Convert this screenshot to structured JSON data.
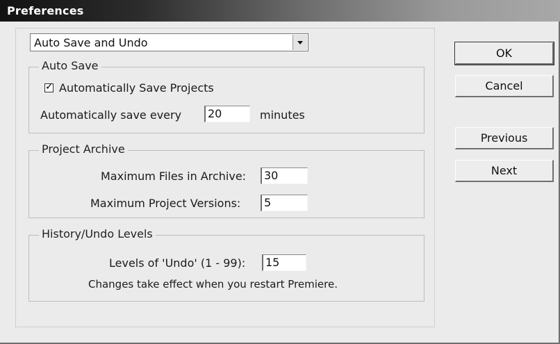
{
  "window": {
    "title": "Preferences"
  },
  "category_select": {
    "value": "Auto Save and Undo"
  },
  "auto_save": {
    "group_title": "Auto Save",
    "checkbox_label": "Automatically Save Projects",
    "checked": true,
    "interval_label": "Automatically save every",
    "interval_value": "20",
    "interval_unit": "minutes"
  },
  "project_archive": {
    "group_title": "Project Archive",
    "max_files_label": "Maximum Files in Archive:",
    "max_files_value": "30",
    "max_versions_label": "Maximum Project Versions:",
    "max_versions_value": "5"
  },
  "history": {
    "group_title": "History/Undo Levels",
    "levels_label": "Levels of 'Undo' (1 - 99):",
    "levels_value": "15",
    "note": "Changes take effect when you restart Premiere."
  },
  "buttons": {
    "ok": "OK",
    "cancel": "Cancel",
    "previous": "Previous",
    "next": "Next"
  }
}
